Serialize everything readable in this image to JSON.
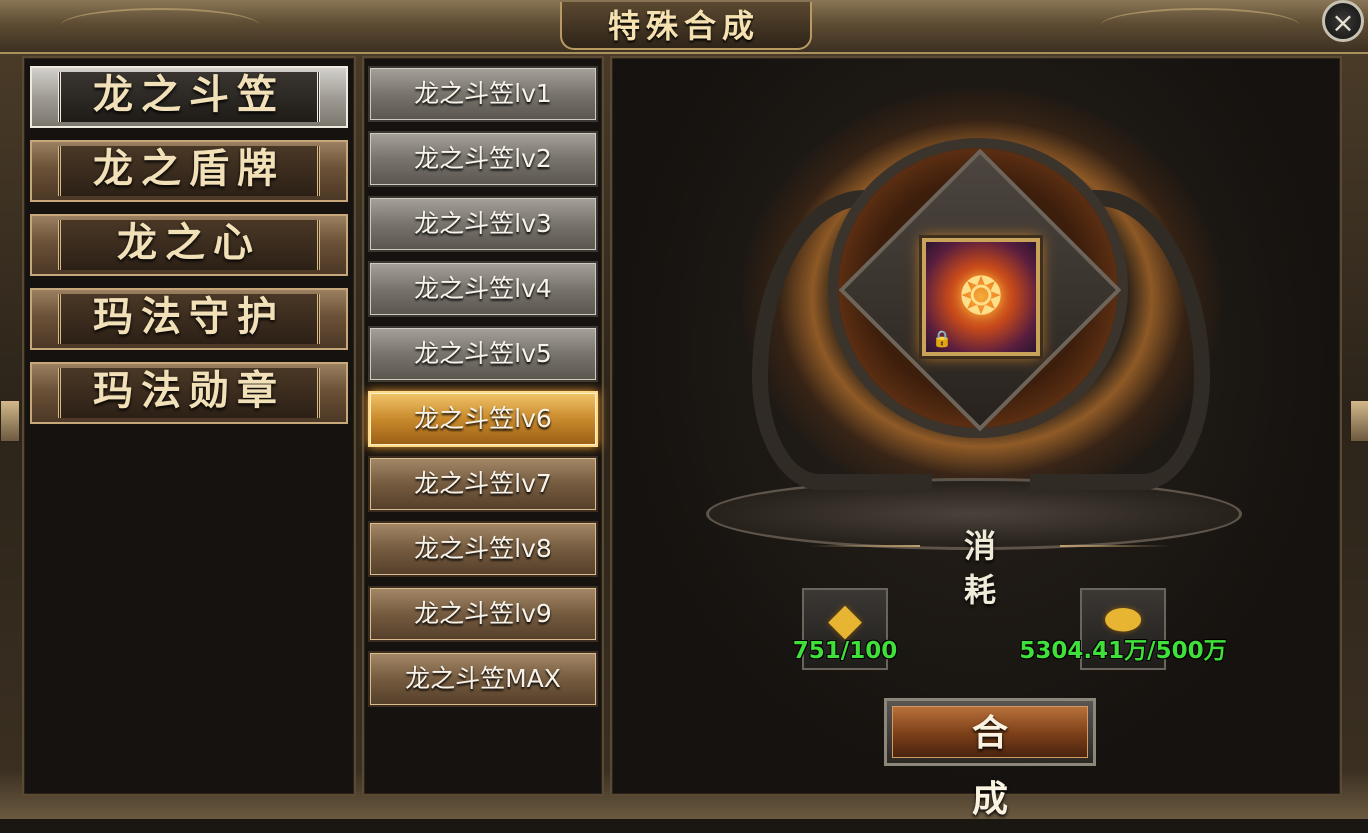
{
  "header": {
    "title": "特殊合成",
    "close_icon": "×"
  },
  "categories": [
    {
      "label": "龙之斗笠",
      "active": true
    },
    {
      "label": "龙之盾牌",
      "active": false
    },
    {
      "label": "龙之心",
      "active": false
    },
    {
      "label": "玛法守护",
      "active": false
    },
    {
      "label": "玛法勋章",
      "active": false
    }
  ],
  "levels": [
    {
      "label": "龙之斗笠lv1",
      "state": "gray"
    },
    {
      "label": "龙之斗笠lv2",
      "state": "gray"
    },
    {
      "label": "龙之斗笠lv3",
      "state": "gray"
    },
    {
      "label": "龙之斗笠lv4",
      "state": "gray"
    },
    {
      "label": "龙之斗笠lv5",
      "state": "gray"
    },
    {
      "label": "龙之斗笠lv6",
      "state": "selected"
    },
    {
      "label": "龙之斗笠lv7",
      "state": "brown"
    },
    {
      "label": "龙之斗笠lv8",
      "state": "brown"
    },
    {
      "label": "龙之斗笠lv9",
      "state": "brown"
    },
    {
      "label": "龙之斗笠MAX",
      "state": "brown"
    }
  ],
  "altar": {
    "item_icon": "dragon-hat-icon",
    "lock_icon": "lock-icon"
  },
  "consume": {
    "label": "消耗",
    "materials": [
      {
        "icon": "gold-ore-icon",
        "amount": "751/100"
      },
      {
        "icon": "gold-ingot-icon",
        "amount": "5304.41万/500万"
      }
    ]
  },
  "synthesize_button": {
    "label": "合成"
  },
  "colors": {
    "amount_green": "#3fe03a",
    "selected_orange": "#f0a030",
    "title_gold": "#f5e2b0"
  }
}
